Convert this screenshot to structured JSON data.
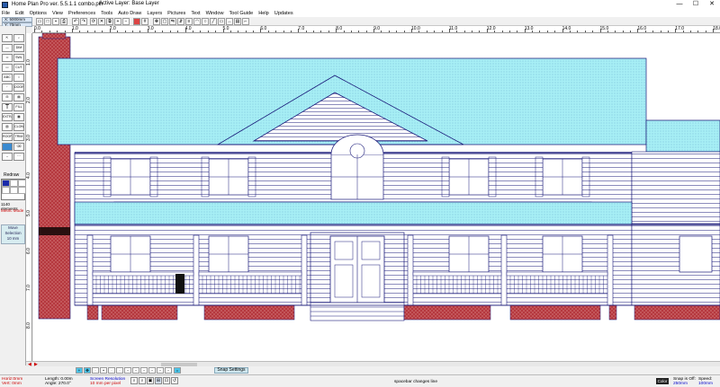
{
  "window": {
    "title": "Home Plan Pro ver. 5.5.1.1   combo.pln",
    "layer": "Active Layer: Base Layer",
    "minimize": "—",
    "maximize": "☐",
    "close": "✕"
  },
  "menu": [
    "File",
    "Edit",
    "Options",
    "View",
    "Preferences",
    "Tools",
    "Auto Draw",
    "Layers",
    "Pictures",
    "Text",
    "Window",
    "Tool Guide",
    "Help",
    "Updates"
  ],
  "coords": {
    "x": "X: 5000mm",
    "y": "Y: 70mm"
  },
  "ruler_top": [
    "0.0",
    "1.0",
    "2.0",
    "3.0",
    "4.0",
    "5.0",
    "6.0",
    "7.0",
    "8.0",
    "9.0",
    "10.0",
    "11.0",
    "12.0",
    "13.0",
    "14.0",
    "15.0",
    "16.0",
    "17.0",
    "18.0"
  ],
  "ruler_left": [
    "1.0",
    "2.0",
    "3.0",
    "4.0",
    "5.0",
    "6.0",
    "7.0",
    "8.0"
  ],
  "toolbox": {
    "redraw": "Redraw",
    "elements": "1140 elements",
    "metric_mode": "Metric Mode",
    "move_selection": [
      "Move",
      "Selection",
      "10 mm"
    ],
    "tools": [
      "DIM",
      "SWL",
      "CUT",
      "ABC",
      "DOOR",
      "T",
      "FILL",
      "EXTRA",
      "CLONE",
      "ROOF",
      "TRIM"
    ]
  },
  "bottom_toolbar": {
    "snap_settings": "Snap Settings"
  },
  "status": {
    "horiz": "Horiz:0mm",
    "vert": "Vert: 0mm",
    "length": "Length: 0.00m",
    "angle": "Angle:  270.0°",
    "screen_res_label": "Screen Resolution",
    "screen_res_value": "10 mm per pixel",
    "hint": "spacebar changes line",
    "color_label": "Color",
    "snap_label": "Snap is Off:",
    "snap_value": "250mm",
    "speed_label": "Speed:",
    "speed_value": "100mm"
  },
  "colors": {
    "roof_fill": "#a7eff5",
    "line": "#1a1a7a",
    "brick": "#b5383e",
    "accent_red": "#cc0000"
  }
}
